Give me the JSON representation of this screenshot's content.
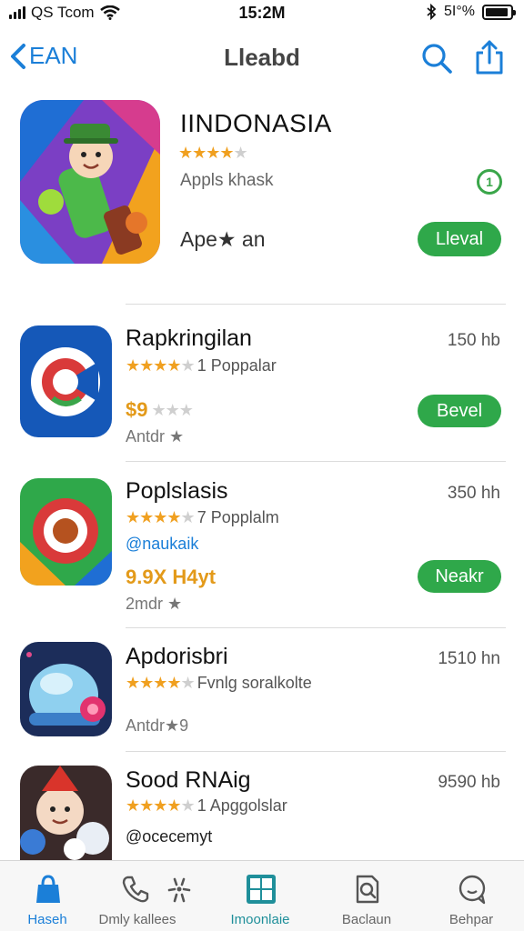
{
  "status_bar": {
    "carrier": "QS Tcom",
    "time": "15:2M",
    "battery": "5I°%"
  },
  "nav": {
    "back_label": "EAN",
    "title": "Lleabd"
  },
  "featured": {
    "name": "IINDONASIA",
    "rating_stars": 4,
    "category": "Appls khask",
    "timer_glyph": "1",
    "subtitle": "Ape★ an",
    "button_label": "Lleval"
  },
  "apps": [
    {
      "name": "Rapkringilan",
      "size": "150 hb",
      "rating_stars": 4.5,
      "rating_text": "1 Poppalar",
      "price": "$9",
      "price_stars": 3,
      "meta": "Antdr ★",
      "button_label": "Bevel"
    },
    {
      "name": "Poplslasis",
      "size": "350 hh",
      "rating_stars": 4.5,
      "rating_text": "7 Popplalm",
      "link": "@naukaik",
      "price": "9.9X H4yt",
      "meta": "2mdr ★",
      "button_label": "Neakr"
    },
    {
      "name": "Apdorisbri",
      "size": "1510 hn",
      "rating_stars": 4,
      "rating_text": "Fvnlg soralkolte",
      "meta": "Antdr★9"
    },
    {
      "name": "Sood RNAig",
      "size": "9590 hb",
      "rating_stars": 4,
      "rating_text": "1 Apggolslar",
      "link": "@ocecemyt"
    }
  ],
  "tabs": [
    {
      "label": "Haseh",
      "icon": "bag-icon",
      "active": true
    },
    {
      "label": "Dmly kallees",
      "icon": "phone-icon",
      "active": false
    },
    {
      "label": "",
      "icon": "sparkle-icon",
      "active": false
    },
    {
      "label": "Imoonlaie",
      "icon": "grid-icon",
      "active": false
    },
    {
      "label": "Baclaun",
      "icon": "search-doc-icon",
      "active": false
    },
    {
      "label": "Behpar",
      "icon": "chat-icon",
      "active": false
    }
  ],
  "colors": {
    "accent": "#1b7fd8",
    "button_green": "#2fa84a",
    "star": "#f0a020"
  }
}
